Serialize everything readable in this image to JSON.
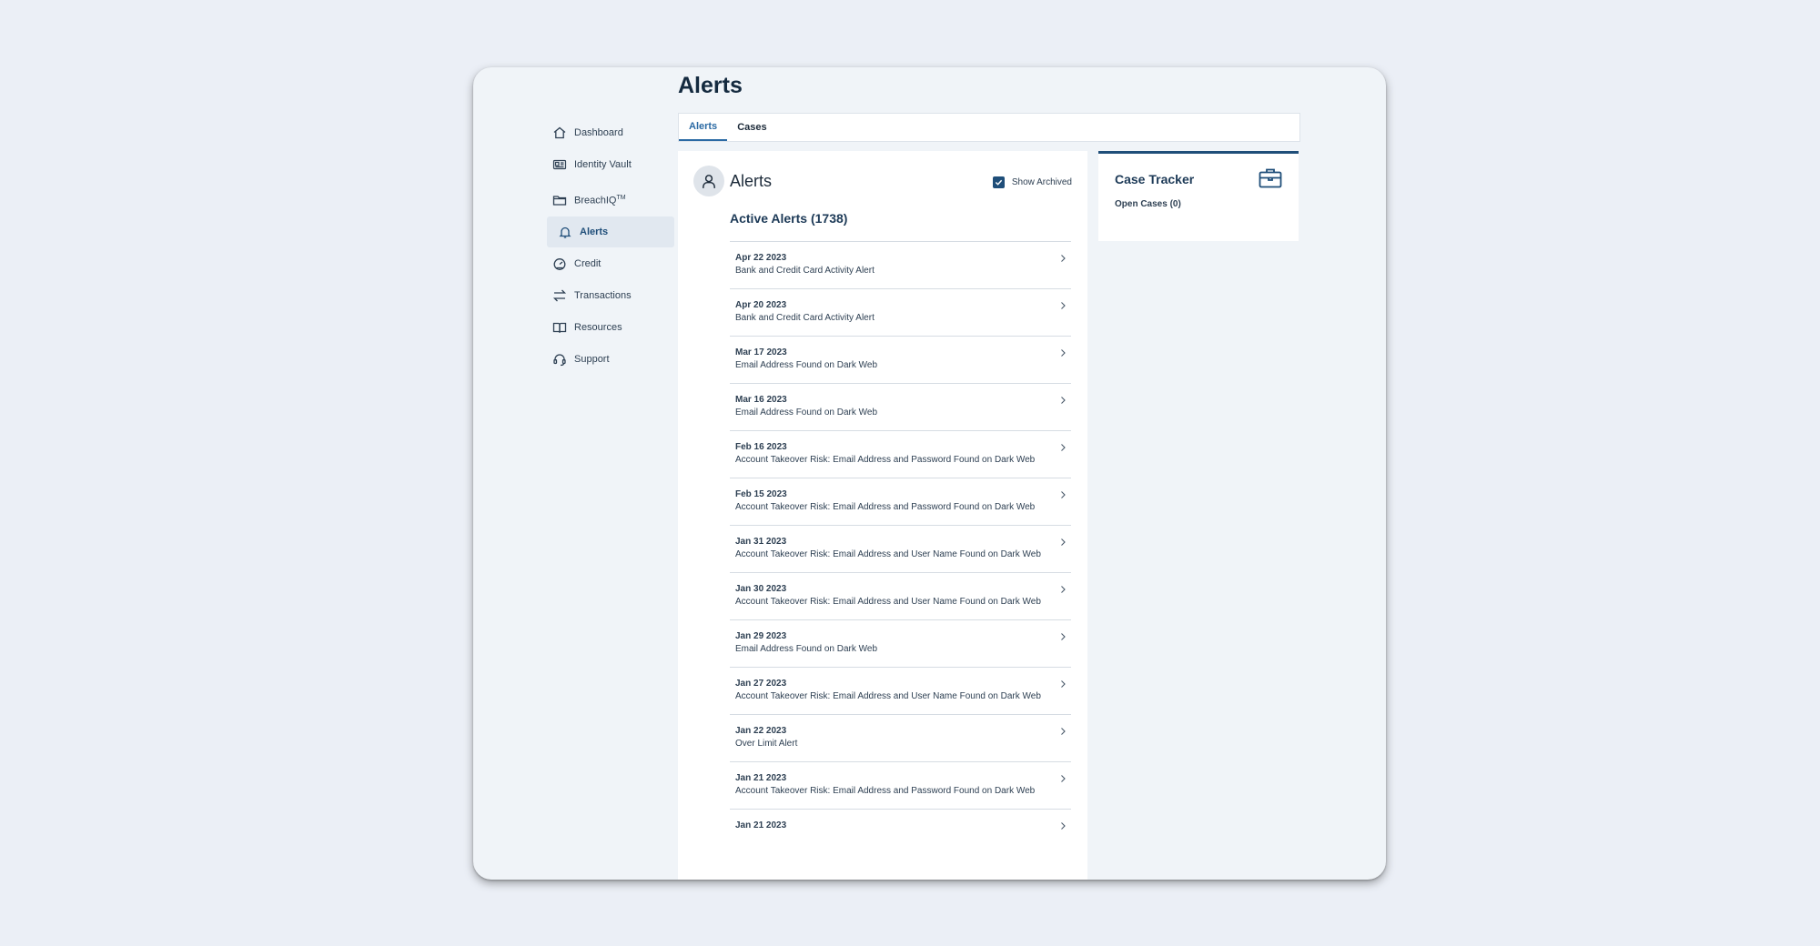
{
  "page": {
    "title": "Alerts"
  },
  "sidebar": {
    "items": [
      {
        "label": "Dashboard",
        "icon": "home-icon"
      },
      {
        "label": "Identity Vault",
        "icon": "id-card-icon"
      },
      {
        "label": "BreachIQ",
        "sup": "TM",
        "icon": "folder-icon"
      },
      {
        "label": "Alerts",
        "icon": "bell-icon",
        "active": true
      },
      {
        "label": "Credit",
        "icon": "gauge-icon"
      },
      {
        "label": "Transactions",
        "icon": "transfer-arrows-icon"
      },
      {
        "label": "Resources",
        "icon": "book-icon"
      },
      {
        "label": "Support",
        "icon": "headset-icon"
      }
    ]
  },
  "tabs": [
    {
      "label": "Alerts",
      "active": true
    },
    {
      "label": "Cases",
      "active": false
    }
  ],
  "alerts_panel": {
    "title": "Alerts",
    "show_archived_label": "Show Archived",
    "show_archived_checked": true,
    "active_heading": "Active Alerts (1738)",
    "alerts": [
      {
        "date": "Apr 22 2023",
        "desc": "Bank and Credit Card Activity Alert"
      },
      {
        "date": "Apr 20 2023",
        "desc": "Bank and Credit Card Activity Alert"
      },
      {
        "date": "Mar 17 2023",
        "desc": "Email Address Found on Dark Web"
      },
      {
        "date": "Mar 16 2023",
        "desc": "Email Address Found on Dark Web"
      },
      {
        "date": "Feb 16 2023",
        "desc": "Account Takeover Risk: Email Address and Password Found on Dark Web"
      },
      {
        "date": "Feb 15 2023",
        "desc": "Account Takeover Risk: Email Address and Password Found on Dark Web"
      },
      {
        "date": "Jan 31 2023",
        "desc": "Account Takeover Risk: Email Address and User Name Found on Dark Web"
      },
      {
        "date": "Jan 30 2023",
        "desc": "Account Takeover Risk: Email Address and User Name Found on Dark Web"
      },
      {
        "date": "Jan 29 2023",
        "desc": "Email Address Found on Dark Web"
      },
      {
        "date": "Jan 27 2023",
        "desc": "Account Takeover Risk: Email Address and User Name Found on Dark Web"
      },
      {
        "date": "Jan 22 2023",
        "desc": "Over Limit Alert"
      },
      {
        "date": "Jan 21 2023",
        "desc": "Account Takeover Risk: Email Address and Password Found on Dark Web"
      },
      {
        "date": "Jan 21 2023",
        "desc": ""
      }
    ]
  },
  "case_tracker": {
    "title": "Case Tracker",
    "open_cases": "Open Cases (0)",
    "icon": "briefcase-icon"
  },
  "colors": {
    "accent": "#1f4e79",
    "tab_active": "#2b6aa4",
    "background": "#ebeff6"
  }
}
